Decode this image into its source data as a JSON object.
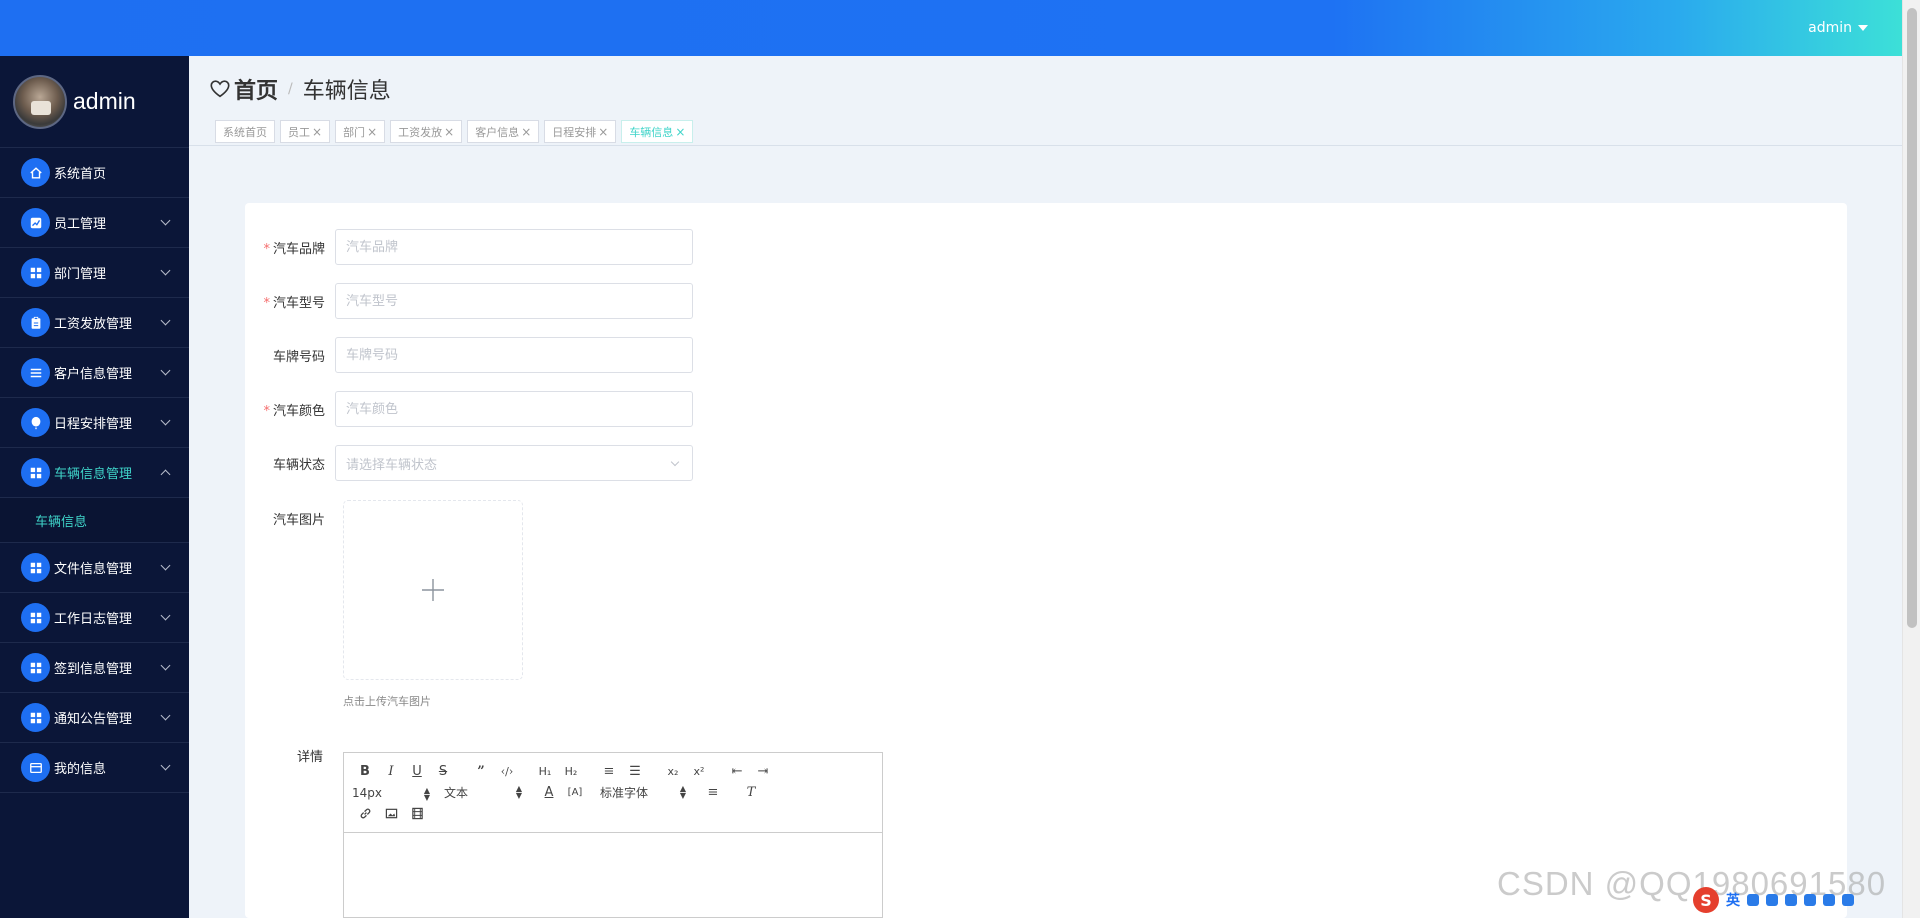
{
  "topbar": {
    "user": "admin"
  },
  "sidebar": {
    "profile_name": "admin",
    "items": [
      {
        "label": "系统首页",
        "icon": "home-icon",
        "expandable": false
      },
      {
        "label": "员工管理",
        "icon": "chart-icon",
        "expandable": true
      },
      {
        "label": "部门管理",
        "icon": "grid-icon",
        "expandable": true
      },
      {
        "label": "工资发放管理",
        "icon": "clipboard-icon",
        "expandable": true
      },
      {
        "label": "客户信息管理",
        "icon": "list-icon",
        "expandable": true
      },
      {
        "label": "日程安排管理",
        "icon": "balloon-icon",
        "expandable": true
      },
      {
        "label": "车辆信息管理",
        "icon": "grid-icon",
        "expandable": true,
        "active": true
      },
      {
        "label": "文件信息管理",
        "icon": "grid-icon",
        "expandable": true
      },
      {
        "label": "工作日志管理",
        "icon": "grid-icon",
        "expandable": true
      },
      {
        "label": "签到信息管理",
        "icon": "grid-icon",
        "expandable": true
      },
      {
        "label": "通知公告管理",
        "icon": "grid-icon",
        "expandable": true
      },
      {
        "label": "我的信息",
        "icon": "card-icon",
        "expandable": true
      }
    ],
    "sub_item": "车辆信息"
  },
  "breadcrumb": {
    "home": "首页",
    "separator": "/",
    "current": "车辆信息"
  },
  "tabs": [
    {
      "label": "系统首页",
      "closable": false
    },
    {
      "label": "员工",
      "closable": true
    },
    {
      "label": "部门",
      "closable": true
    },
    {
      "label": "工资发放",
      "closable": true
    },
    {
      "label": "客户信息",
      "closable": true
    },
    {
      "label": "日程安排",
      "closable": true
    },
    {
      "label": "车辆信息",
      "closable": true,
      "active": true
    }
  ],
  "form": {
    "brand": {
      "label": "汽车品牌",
      "placeholder": "汽车品牌",
      "required": true
    },
    "model": {
      "label": "汽车型号",
      "placeholder": "汽车型号",
      "required": true
    },
    "plate": {
      "label": "车牌号码",
      "placeholder": "车牌号码",
      "required": false
    },
    "color": {
      "label": "汽车颜色",
      "placeholder": "汽车颜色",
      "required": true
    },
    "status": {
      "label": "车辆状态",
      "placeholder": "请选择车辆状态"
    },
    "image": {
      "label": "汽车图片",
      "tip": "点击上传汽车图片"
    },
    "detail": {
      "label": "详情"
    }
  },
  "editor": {
    "font_size": "14px",
    "header": "文本",
    "font": "标准字体"
  },
  "watermark": "CSDN @QQ1980691580",
  "ime": {
    "lang": "英"
  },
  "colors": {
    "accent": "#1e6ff2",
    "active": "#3fd4c9",
    "sidebar": "#0b1638",
    "required": "#f56c6c"
  }
}
